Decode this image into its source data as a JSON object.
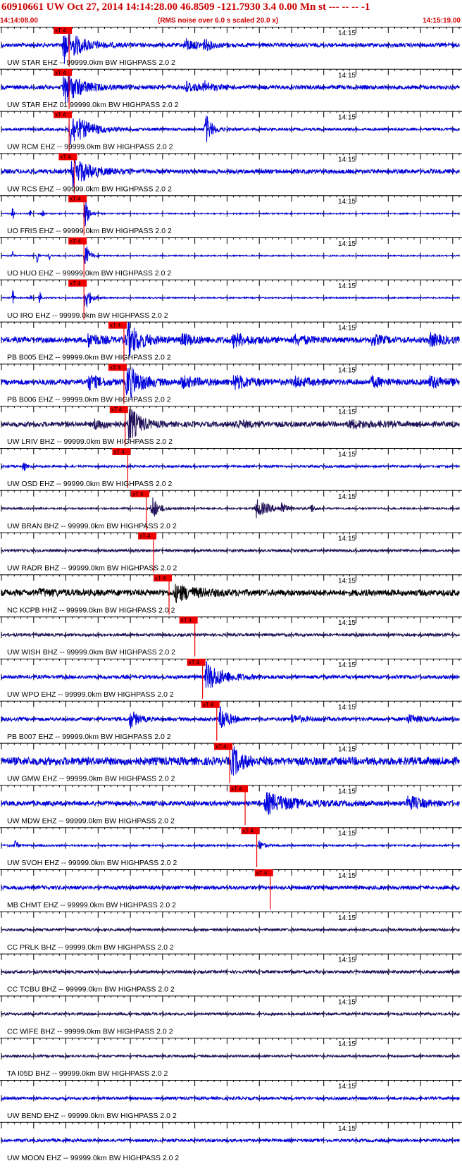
{
  "header": {
    "title": "60910661 UW Oct 27, 2014 14:14:28.00   46.8509 -121.7930  3.4 0.00 Mn st --- -- --  -1",
    "time_start": "14:14:08.00",
    "time_end": "14:15:19.00",
    "subtitle": "(RMS noise over 6.0 s scaled 20.0 x)"
  },
  "colors": {
    "title": "#cc0000",
    "pick": "#ee0000",
    "trace_blue": "#0000dd",
    "trace_navy": "#22115a",
    "trace_black": "#000000"
  },
  "chart_data": {
    "type": "line",
    "x_unit": "s",
    "x_range": [
      0,
      71
    ],
    "minute_label": "14:15",
    "minute_label_time": 52,
    "pick_label": "xT 4",
    "traces": [
      {
        "label": "UW STAR EHZ -- 99999.0km BW  HIGHPASS  2.0  2",
        "color": "#0000dd",
        "noise": 0.11,
        "pick": 10.5,
        "bursts": [
          [
            9.7,
            5.2,
            1.0
          ],
          [
            28.5,
            3.8,
            0.32
          ],
          [
            31.5,
            2.5,
            0.25
          ]
        ]
      },
      {
        "label": "UW STAR EHZ 01 99999.0km BW  HIGHPASS  2.0  2",
        "color": "#0000dd",
        "noise": 0.11,
        "pick": 10.5,
        "bursts": [
          [
            9.7,
            5.2,
            1.0
          ],
          [
            28.5,
            3.8,
            0.32
          ],
          [
            31.5,
            2.5,
            0.25
          ]
        ]
      },
      {
        "label": "UW RCM EHZ -- 99999.0km BW  HIGHPASS  2.0  2",
        "color": "#0000dd",
        "noise": 0.07,
        "pick": 10.5,
        "bursts": [
          [
            10.6,
            6.0,
            0.95
          ],
          [
            31.7,
            2.0,
            0.85
          ]
        ]
      },
      {
        "label": "UW RCS EHZ -- 99999.0km BW  HIGHPASS  2.0  2",
        "color": "#0000dd",
        "noise": 0.12,
        "pick": 11.3,
        "bursts": [
          [
            11.0,
            5.5,
            0.85
          ]
        ]
      },
      {
        "label": "UO FRIS EHZ -- 99999.0km BW  HIGHPASS  2.0  2",
        "color": "#0000dd",
        "noise": 0.03,
        "pick": 12.8,
        "bursts": [
          [
            13.0,
            1.2,
            0.8
          ],
          [
            1.8,
            0.3,
            0.45
          ],
          [
            4.5,
            0.2,
            0.2
          ],
          [
            6.5,
            0.3,
            0.3
          ]
        ]
      },
      {
        "label": "UO HUO EHZ -- 99999.0km BW  HIGHPASS  2.0  2",
        "color": "#0000dd",
        "noise": 0.03,
        "pick": 12.8,
        "bursts": [
          [
            13.0,
            1.2,
            0.85
          ],
          [
            1.8,
            0.2,
            0.3
          ],
          [
            5.6,
            0.3,
            0.5
          ],
          [
            7.5,
            0.2,
            0.25
          ]
        ]
      },
      {
        "label": "UO IRO EHZ -- 99999.0km BW  HIGHPASS  2.0  2",
        "color": "#0000dd",
        "noise": 0.03,
        "pick": 12.8,
        "bursts": [
          [
            13.0,
            1.5,
            0.85
          ],
          [
            1.8,
            0.3,
            0.55
          ],
          [
            4.6,
            0.2,
            0.3
          ],
          [
            6.0,
            0.3,
            0.4
          ]
        ]
      },
      {
        "label": "PB B005 EHZ -- 99999.0km BW  HIGHPASS  2.0  2",
        "color": "#0000dd",
        "noise": 0.15,
        "pick": 19.0,
        "bursts": [
          [
            13.5,
            4.0,
            0.35
          ],
          [
            19.5,
            4.5,
            0.95
          ],
          [
            28.0,
            6.0,
            0.25
          ],
          [
            36.0,
            6.0,
            0.32
          ],
          [
            45.5,
            5.0,
            0.22
          ],
          [
            57.5,
            4.0,
            0.25
          ],
          [
            66.5,
            5.0,
            0.3
          ]
        ]
      },
      {
        "label": "PB B006 EHZ -- 99999.0km BW  HIGHPASS  2.0  2",
        "color": "#0000dd",
        "noise": 0.15,
        "pick": 19.0,
        "bursts": [
          [
            13.5,
            4.0,
            0.38
          ],
          [
            19.5,
            4.5,
            0.95
          ],
          [
            28.0,
            6.0,
            0.25
          ],
          [
            36.0,
            6.0,
            0.35
          ],
          [
            45.5,
            5.0,
            0.22
          ],
          [
            57.5,
            4.0,
            0.25
          ],
          [
            66.5,
            5.0,
            0.3
          ]
        ]
      },
      {
        "label": "UW LRIV BHZ -- 99999.0km BW  HIGHPASS  2.0  2",
        "color": "#22115a",
        "noise": 0.14,
        "pick": 19.2,
        "bursts": [
          [
            14.5,
            4.0,
            0.25
          ],
          [
            19.8,
            3.5,
            1.0
          ],
          [
            36.0,
            6.0,
            0.18
          ],
          [
            54.0,
            8.0,
            0.18
          ]
        ]
      },
      {
        "label": "UW OSD EHZ -- 99999.0km BW  HIGHPASS  2.0  2",
        "color": "#0000dd",
        "noise": 0.06,
        "pick": 19.6,
        "bursts": [
          [
            3.5,
            0.6,
            0.3
          ]
        ]
      },
      {
        "label": "UW BRAN BHZ -- 99999.0km BW  HIGHPASS  2.0  2",
        "color": "#22115a",
        "noise": 0.05,
        "pick": 22.5,
        "bursts": [
          [
            23.4,
            1.8,
            0.75
          ],
          [
            39.5,
            4.5,
            0.5
          ],
          [
            43.5,
            1.0,
            0.35
          ],
          [
            48.0,
            1.0,
            0.3
          ]
        ]
      },
      {
        "label": "UW RADR BHZ -- 99999.0km BW  HIGHPASS  2.0  2",
        "color": "#22115a",
        "noise": 0.07,
        "pick": 23.6,
        "bursts": []
      },
      {
        "label": "NC KCPB HHZ -- 99999.0km BW  HIGHPASS  2.0  2",
        "color": "#000000",
        "noise": 0.17,
        "pick": 26.0,
        "bursts": [
          [
            27.0,
            7.0,
            0.4
          ],
          [
            6.0,
            5.0,
            0.12
          ]
        ]
      },
      {
        "label": "UW WISH BHZ -- 99999.0km BW  HIGHPASS  2.0  2",
        "color": "#22115a",
        "noise": 0.08,
        "pick": 30.0,
        "bursts": []
      },
      {
        "label": "UW WPO EHZ -- 99999.0km BW  HIGHPASS  2.0  2",
        "color": "#0000dd",
        "noise": 0.1,
        "pick": 31.2,
        "bursts": [
          [
            31.8,
            5.5,
            0.8
          ]
        ]
      },
      {
        "label": "PB B007 EHZ -- 99999.0km BW  HIGHPASS  2.0  2",
        "color": "#0000dd",
        "noise": 0.1,
        "pick": 33.4,
        "bursts": [
          [
            20.0,
            2.5,
            0.5
          ],
          [
            34.0,
            2.5,
            0.75
          ],
          [
            45.0,
            4.0,
            0.2
          ],
          [
            63.0,
            4.0,
            0.22
          ]
        ]
      },
      {
        "label": "UW GMW EHZ -- 99999.0km BW  HIGHPASS  2.0  2",
        "color": "#0000dd",
        "noise": 0.22,
        "pick": 35.4,
        "bursts": [
          [
            35.8,
            3.0,
            0.8
          ]
        ]
      },
      {
        "label": "UW MDW EHZ -- 99999.0km BW  HIGHPASS  2.0  2",
        "color": "#0000dd",
        "noise": 0.13,
        "pick": 37.8,
        "bursts": [
          [
            41.0,
            9.0,
            0.55
          ],
          [
            63.0,
            5.0,
            0.4
          ]
        ]
      },
      {
        "label": "UW SVOH EHZ -- 99999.0km BW  HIGHPASS  2.0  2",
        "color": "#0000dd",
        "noise": 0.05,
        "pick": 39.6,
        "bursts": [
          [
            2.2,
            0.5,
            0.4
          ],
          [
            40.0,
            1.5,
            0.3
          ]
        ]
      },
      {
        "label": "MB CHMT EHZ -- 99999.0km BW  HIGHPASS  2.0  2",
        "color": "#0000dd",
        "noise": 0.1,
        "pick": 41.7,
        "bursts": []
      },
      {
        "label": "CC PRLK BHZ -- 99999.0km BW  HIGHPASS  2.0  2",
        "color": "#22115a",
        "noise": 0.07,
        "pick": null,
        "bursts": []
      },
      {
        "label": "CC TCBU BHZ -- 99999.0km BW  HIGHPASS  2.0  2",
        "color": "#22115a",
        "noise": 0.08,
        "pick": null,
        "bursts": []
      },
      {
        "label": "CC WIFE BHZ -- 99999.0km BW  HIGHPASS  2.0  2",
        "color": "#22115a",
        "noise": 0.07,
        "pick": null,
        "bursts": []
      },
      {
        "label": "TA I05D BHZ -- 99999.0km BW  HIGHPASS  2.0  2",
        "color": "#22115a",
        "noise": 0.06,
        "pick": null,
        "bursts": []
      },
      {
        "label": "UW BEND EHZ -- 99999.0km BW  HIGHPASS  2.0  2",
        "color": "#0000dd",
        "noise": 0.08,
        "pick": null,
        "bursts": []
      },
      {
        "label": "UW MOON EHZ -- 99999.0km BW  HIGHPASS  2.0  2",
        "color": "#0000dd",
        "noise": 0.08,
        "pick": null,
        "bursts": []
      }
    ]
  }
}
